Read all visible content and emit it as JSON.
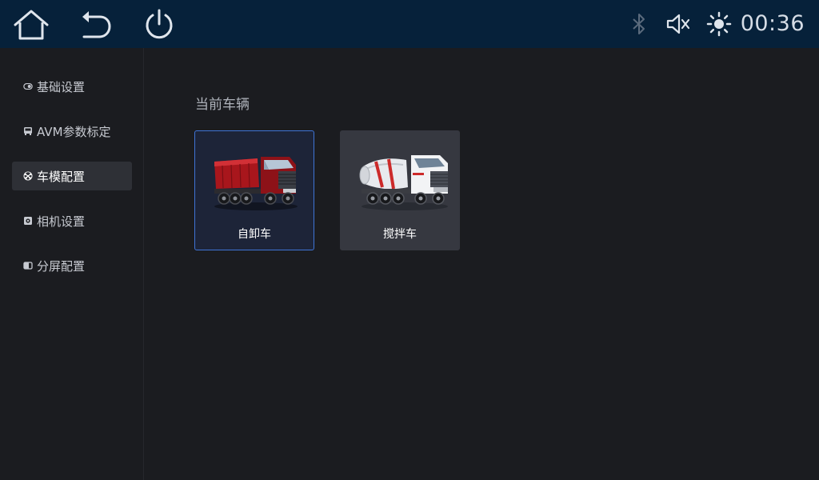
{
  "topbar": {
    "home_icon": "home-icon",
    "back_icon": "back-arrow-icon",
    "power_icon": "power-icon",
    "bluetooth_icon": "bluetooth-icon",
    "mute_icon": "speaker-muted-icon",
    "brightness_icon": "brightness-icon",
    "clock": "00:36"
  },
  "sidebar": {
    "items": [
      {
        "label": "基础设置",
        "icon": "toggle-icon",
        "active": false
      },
      {
        "label": "AVM参数标定",
        "icon": "bus-icon",
        "active": false
      },
      {
        "label": "车模配置",
        "icon": "wheel-icon",
        "active": true
      },
      {
        "label": "相机设置",
        "icon": "camera-icon",
        "active": false
      },
      {
        "label": "分屏配置",
        "icon": "split-screen-icon",
        "active": false
      }
    ]
  },
  "main": {
    "section_title": "当前车辆",
    "vehicles": [
      {
        "label": "自卸车",
        "image": "dump-truck",
        "selected": true
      },
      {
        "label": "搅拌车",
        "image": "mixer-truck",
        "selected": false
      }
    ]
  },
  "colors": {
    "topbar_bg": "#06213a",
    "page_bg": "#1b1c20",
    "active_nav_bg": "#2e3036",
    "selected_border": "#3f74d6"
  }
}
